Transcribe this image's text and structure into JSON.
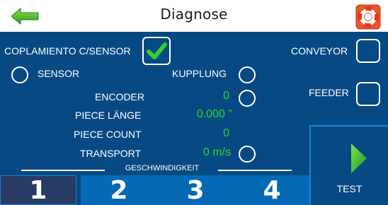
{
  "header": {
    "title": "Diagnose",
    "back_icon": "back-arrow-icon",
    "help_icon": "lifebuoy-help-icon"
  },
  "main": {
    "coupling_label": "COPLAMIENTO C/SENSOR",
    "coupling_checked": true,
    "sensor_label": "SENSOR",
    "kupplung_label": "KUPPLUNG",
    "encoder_label": "ENCODER",
    "encoder_value": "0",
    "piece_length_label": "PIECE LÄNGE",
    "piece_length_value": "0.000 \"",
    "piece_count_label": "PIECE COUNT",
    "piece_count_value": "0",
    "transport_label": "TRANSPORT",
    "transport_value": "0 m/s",
    "conveyor_label": "CONVEYOR",
    "feeder_label": "FEEDER"
  },
  "speed": {
    "label": "GESCHWINDIGKEIT",
    "buttons": [
      "1",
      "2",
      "3",
      "4"
    ],
    "selected": "1"
  },
  "test": {
    "label": "TEST",
    "icon": "play-icon"
  },
  "colors": {
    "panel_bg": "#074a83",
    "value_green": "#2ed22e",
    "button_blue": "#0569b6",
    "selected_button": "#283c66"
  }
}
